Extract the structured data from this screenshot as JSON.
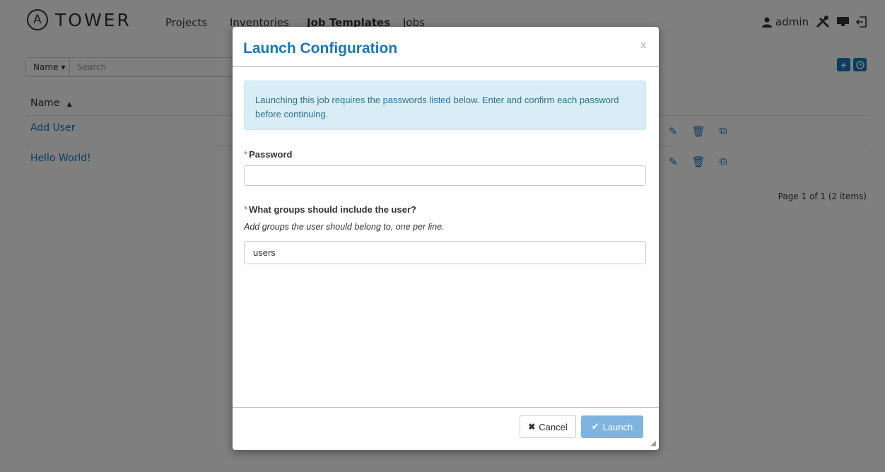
{
  "nav": {
    "logo_letter": "A",
    "logo_text": "TOWER",
    "links": [
      "Projects",
      "Inventories",
      "Job Templates",
      "Jobs"
    ],
    "user": "admin"
  },
  "search": {
    "field": "Name",
    "placeholder": "Search"
  },
  "table": {
    "header": "Name",
    "rows": [
      "Add User",
      "Hello World!"
    ],
    "pager": "Page 1 of 1 (2 items)"
  },
  "modal": {
    "title": "Launch Configuration",
    "close": "x",
    "alert": "Launching this job requires the passwords listed below. Enter and confirm each password before continuing.",
    "password_label": "Password",
    "groups_label": "What groups should include the user?",
    "groups_help": "Add groups the user should belong to, one per line.",
    "groups_value": "users",
    "cancel_label": "Cancel",
    "launch_label": "Launch"
  },
  "colors": {
    "accent": "#1778be",
    "alert_bg": "#d9edf7",
    "launch_disabled": "#7fb3e0",
    "required": "#d9534f"
  }
}
